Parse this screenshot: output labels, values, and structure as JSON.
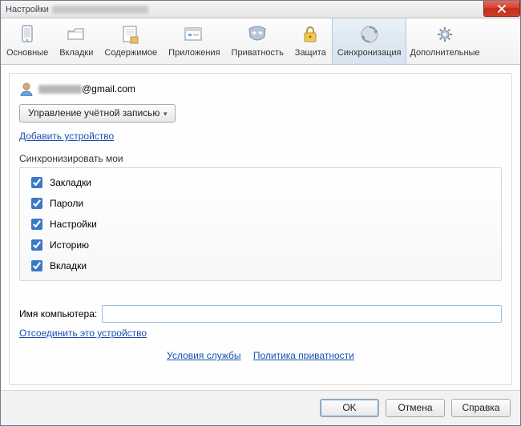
{
  "window": {
    "title": "Настройки"
  },
  "toolbar": {
    "items": [
      {
        "id": "general",
        "label": "Основные"
      },
      {
        "id": "tabs",
        "label": "Вкладки"
      },
      {
        "id": "content",
        "label": "Содержимое"
      },
      {
        "id": "apps",
        "label": "Приложения"
      },
      {
        "id": "privacy",
        "label": "Приватность"
      },
      {
        "id": "security",
        "label": "Защита"
      },
      {
        "id": "sync",
        "label": "Синхронизация"
      },
      {
        "id": "advanced",
        "label": "Дополнительные"
      }
    ],
    "active_id": "sync"
  },
  "sync": {
    "email_suffix": "@gmail.com",
    "manage_account_label": "Управление учётной записью",
    "add_device_link": "Добавить устройство",
    "sync_heading": "Синхронизировать мои",
    "checks": [
      {
        "id": "bookmarks",
        "label": "Закладки",
        "checked": true
      },
      {
        "id": "passwords",
        "label": "Пароли",
        "checked": true
      },
      {
        "id": "prefs",
        "label": "Настройки",
        "checked": true
      },
      {
        "id": "history",
        "label": "Историю",
        "checked": true
      },
      {
        "id": "tabs",
        "label": "Вкладки",
        "checked": true
      }
    ],
    "computer_name_label": "Имя компьютера:",
    "computer_name_value": "",
    "unlink_device_link": "Отсоединить это устройство",
    "tos_link": "Условия службы",
    "privacy_link": "Политика приватности"
  },
  "footer": {
    "ok": "OK",
    "cancel": "Отмена",
    "help": "Справка"
  }
}
